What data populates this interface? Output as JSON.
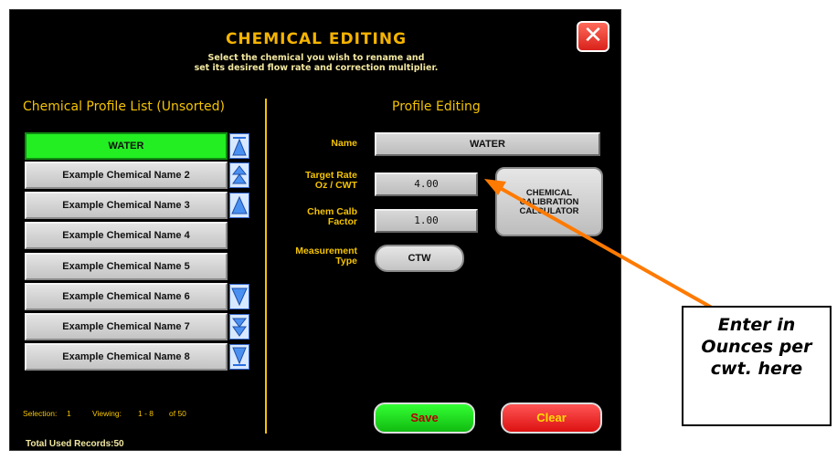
{
  "header": {
    "title": "CHEMICAL EDITING",
    "subtitle_line1": "Select the chemical you wish to rename and",
    "subtitle_line2": "set its desired flow rate and correction multiplier.",
    "close_label": "✕"
  },
  "chemical_list": {
    "header": "Chemical Profile List (Unsorted)",
    "items": [
      {
        "label": "WATER",
        "selected": true
      },
      {
        "label": "Example Chemical Name 2"
      },
      {
        "label": "Example Chemical Name 3"
      },
      {
        "label": "Example Chemical Name 4"
      },
      {
        "label": "Example Chemical Name 5"
      },
      {
        "label": "Example Chemical Name 6"
      },
      {
        "label": "Example Chemical Name 7"
      },
      {
        "label": "Example Chemical Name 8"
      }
    ],
    "scroll_buttons": [
      "scroll-to-top",
      "page-up",
      "line-up",
      "line-down",
      "page-down",
      "scroll-to-bottom"
    ],
    "status": {
      "selection_label": "Selection:",
      "selection_value": "1",
      "viewing_label": "Viewing:",
      "viewing_range": "1 - 8",
      "viewing_total": "of 50"
    },
    "total_label": "Total Used Records:",
    "total_value": "50"
  },
  "profile_editing": {
    "header": "Profile Editing",
    "name_label": "Name",
    "name_value": "WATER",
    "target_rate_label_line1": "Target Rate",
    "target_rate_label_line2": "Oz / CWT",
    "target_rate_value": "4.00",
    "chem_calb_label_line1": "Chem Calb",
    "chem_calb_label_line2": "Factor",
    "chem_calb_value": "1.00",
    "measurement_label_line1": "Measurement",
    "measurement_label_line2": "Type",
    "measurement_value": "CTW",
    "calibration_button_line1": "CHEMICAL",
    "calibration_button_line2": "CALIBRATION",
    "calibration_button_line3": "CALCULATOR",
    "save_label": "Save",
    "clear_label": "Clear"
  },
  "annotation": {
    "line1": "Enter in",
    "line2": "Ounces per",
    "line3": "cwt. here",
    "arrow_color": "#ff7a00"
  },
  "colors": {
    "accent_yellow": "#f5c400",
    "title_gold": "#f5b400",
    "selected_green": "#22ee22",
    "background": "#000000"
  }
}
